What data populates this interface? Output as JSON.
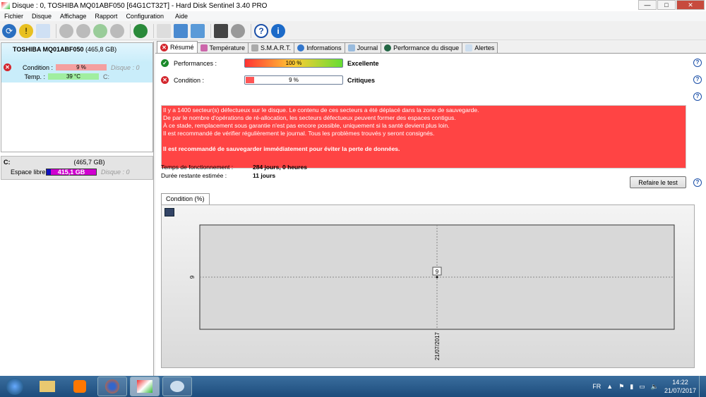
{
  "window": {
    "title": "Disque : 0, TOSHIBA MQ01ABF050 [64G1CT32T]  -  Hard Disk Sentinel 3.40 PRO",
    "min": "—",
    "max": "□",
    "close": "✕"
  },
  "menu": [
    "Fichier",
    "Disque",
    "Affichage",
    "Rapport",
    "Configuration",
    "Aide"
  ],
  "disk": {
    "name": "TOSHIBA MQ01ABF050",
    "size": "(465,8 GB)",
    "condition_label": "Condition :",
    "condition_value": "9 %",
    "condition_pct": 9,
    "disk_index": "Disque : 0",
    "temp_label": "Temp. :",
    "temp_value": "39 °C",
    "drive_letter": "C:"
  },
  "volume": {
    "letter": "C:",
    "size": "(465,7 GB)",
    "free_label": "Espace libre",
    "free_value": "415,1 GB",
    "disk_index": "Disque : 0"
  },
  "tabs": [
    "Résumé",
    "Température",
    "S.M.A.R.T.",
    "Informations",
    "Journal",
    "Performance du disque",
    "Alertes"
  ],
  "summary": {
    "performance_label": "Performances :",
    "performance_value": "100 %",
    "performance_pct": 100,
    "performance_status": "Excellente",
    "condition_label": "Condition :",
    "condition_value": "9 %",
    "condition_pct": 9,
    "condition_status": "Critiques",
    "alert_lines": [
      "Il y a 1400 secteur(s) défectueux sur le disque. Le contenu de ces secteurs a été déplacé dans la zone de sauvegarde.",
      "De par le nombre d'opérations de ré-allocation, les secteurs défectueux peuvent former des espaces contigus.",
      "À ce stade, remplacement sous garantie n'est pas encore possible, uniquement si la santé devient plus loin.",
      "Il est recommandé de vérifier régulièrement le journal. Tous les problèmes trouvés y seront consignés."
    ],
    "alert_bold": "Il est recommandé de sauvegarder immédiatement pour éviter la perte de données.",
    "uptime_label": "Temps de fonctionnement :",
    "uptime_value": "284 jours, 0 heures",
    "remaining_label": "Durée restante estimée :",
    "remaining_value": "11 jours",
    "retest_button": "Refaire le test",
    "help": "?"
  },
  "chart_data": {
    "type": "line",
    "title": "Condition (%)",
    "x": [
      "21/07/2017"
    ],
    "values": [
      9
    ],
    "y_ticks": [
      "9"
    ],
    "data_labels": [
      "9"
    ]
  },
  "taskbar": {
    "lang": "FR",
    "time": "14:22",
    "date": "21/07/2017"
  }
}
